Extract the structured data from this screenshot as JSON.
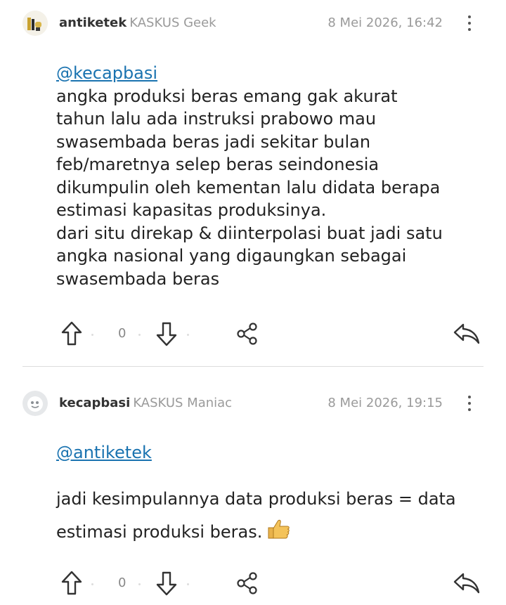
{
  "posts": [
    {
      "username": "antiketek",
      "rank": "KASKUS Geek",
      "date": "8 Mei 2026, 16:42",
      "mention": "@kecapbasi",
      "lines": [
        "angka produksi beras emang gak akurat",
        "tahun lalu ada instruksi prabowo mau",
        "swasembada beras jadi sekitar bulan",
        "feb/maretnya selep beras seindonesia",
        "dikumpulin oleh kementan lalu didata berapa",
        "estimasi kapasitas produksinya.",
        "dari situ direkap & diinterpolasi buat jadi satu",
        "angka nasional yang digaungkan sebagai",
        "swasembada beras"
      ],
      "vote_count": "0"
    },
    {
      "username": "kecapbasi",
      "rank": "KASKUS Maniac",
      "date": "8 Mei 2026, 19:15",
      "mention": "@antiketek",
      "lines": [
        "jadi kesimpulannya data produksi beras = data",
        "estimasi produksi beras."
      ],
      "emoji": "thumbs-up-icon",
      "vote_count": "0"
    }
  ]
}
